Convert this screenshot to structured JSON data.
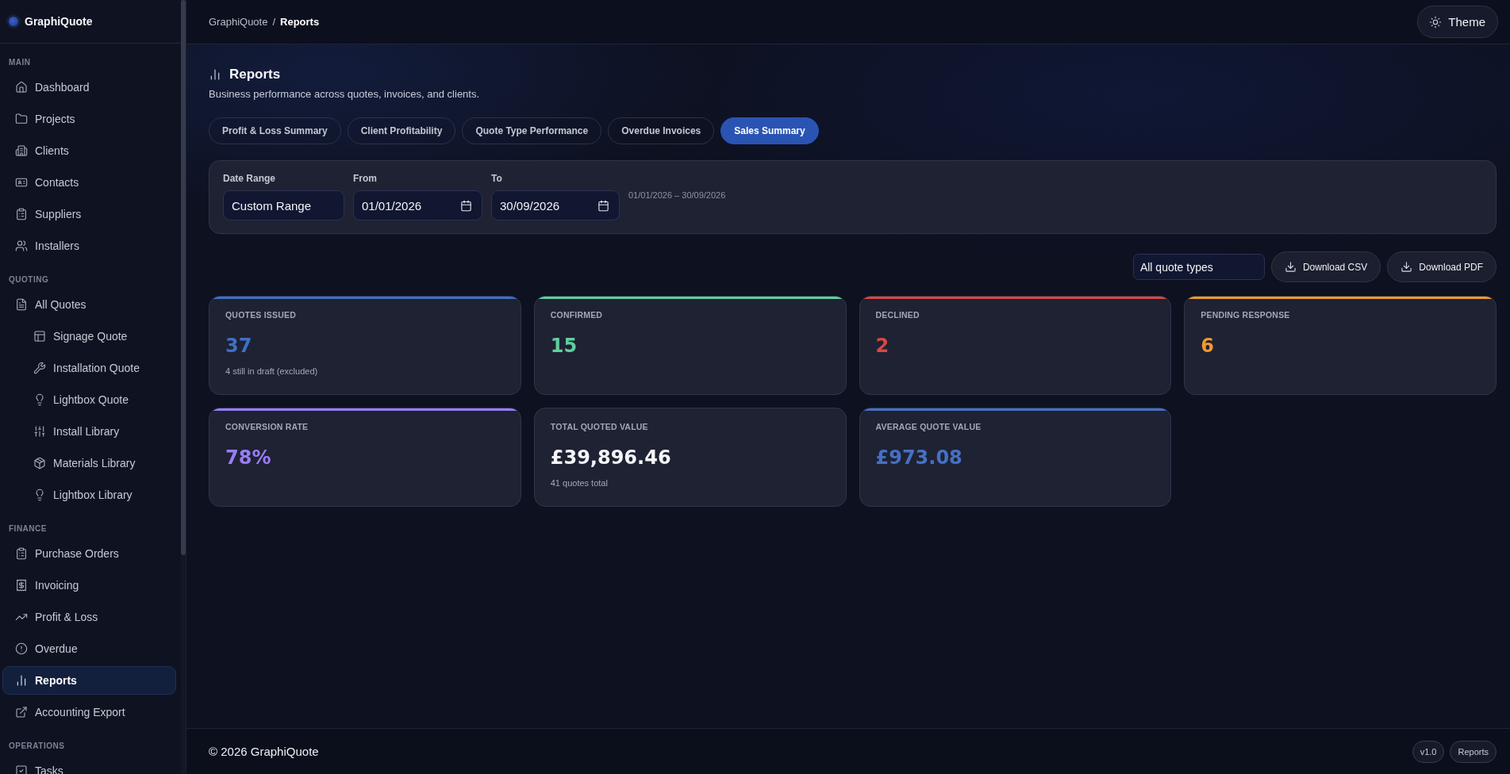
{
  "sidebar": {
    "brand": "GraphiQuote",
    "sections": [
      {
        "title": "MAIN",
        "items": [
          {
            "label": "Dashboard",
            "selected": false
          },
          {
            "label": "Projects",
            "selected": false
          },
          {
            "label": "Clients",
            "selected": false
          },
          {
            "label": "Contacts",
            "selected": false
          },
          {
            "label": "Suppliers",
            "selected": false
          },
          {
            "label": "Installers",
            "selected": false
          }
        ]
      },
      {
        "title": "QUOTING",
        "items": [
          {
            "label": "All Quotes",
            "selected": false,
            "children": [
              {
                "label": "Signage Quote",
                "selected": false
              },
              {
                "label": "Installation Quote",
                "selected": false
              },
              {
                "label": "Lightbox Quote",
                "selected": false
              },
              {
                "label": "Install Library",
                "selected": false
              },
              {
                "label": "Materials Library",
                "selected": false
              },
              {
                "label": "Lightbox Library",
                "selected": false
              }
            ]
          }
        ]
      },
      {
        "title": "FINANCE",
        "items": [
          {
            "label": "Purchase Orders",
            "selected": false
          },
          {
            "label": "Invoicing",
            "selected": false
          },
          {
            "label": "Profit & Loss",
            "selected": false
          },
          {
            "label": "Overdue",
            "selected": false
          },
          {
            "label": "Reports",
            "selected": true
          },
          {
            "label": "Accounting Export",
            "selected": false
          }
        ]
      },
      {
        "title": "OPERATIONS",
        "items": [
          {
            "label": "Tasks",
            "selected": false
          }
        ]
      }
    ]
  },
  "top_bar": {
    "breadcrumb": {
      "items": [
        "GraphiQuote",
        "Reports"
      ],
      "separator": "/"
    },
    "theme_button": "Theme"
  },
  "page": {
    "title": "Reports",
    "subtitle": "Business performance across quotes, invoices, and clients."
  },
  "tabs": [
    {
      "label": "Profit & Loss Summary",
      "selected": false
    },
    {
      "label": "Client Profitability",
      "selected": false
    },
    {
      "label": "Quote Type Performance",
      "selected": false
    },
    {
      "label": "Overdue Invoices",
      "selected": false
    },
    {
      "label": "Sales Summary",
      "selected": true
    }
  ],
  "filters": {
    "date_range": {
      "label": "Date Range",
      "value": "Custom Range"
    },
    "from": {
      "label": "From",
      "value": "01/01/2026"
    },
    "to": {
      "label": "To",
      "value": "30/09/2026"
    },
    "range_text": "01/01/2026 – 30/09/2026"
  },
  "actions": {
    "quote_type": {
      "value": "All quote types"
    },
    "buttons": [
      "Download CSV",
      "Download PDF"
    ]
  },
  "cards": [
    {
      "label": "QUOTES ISSUED",
      "value": "37",
      "note": "4 still in draft (excluded)",
      "color": "#3f6fc6"
    },
    {
      "label": "CONFIRMED",
      "value": "15",
      "color": "#5fcf9c"
    },
    {
      "label": "DECLINED",
      "value": "2",
      "color": "#dc4642"
    },
    {
      "label": "PENDING RESPONSE",
      "value": "6",
      "color": "#f09a2c"
    },
    {
      "label": "CONVERSION RATE",
      "value": "78%",
      "color": "#9a7cf6"
    },
    {
      "label": "TOTAL QUOTED VALUE",
      "value": "£39,896.46",
      "note": "41 quotes total"
    },
    {
      "label": "AVERAGE QUOTE VALUE",
      "value": "£973.08",
      "color": "#4570c4"
    }
  ],
  "footer": {
    "copyright": "© 2026 GraphiQuote",
    "tags": [
      "v1.0",
      "Reports"
    ]
  }
}
